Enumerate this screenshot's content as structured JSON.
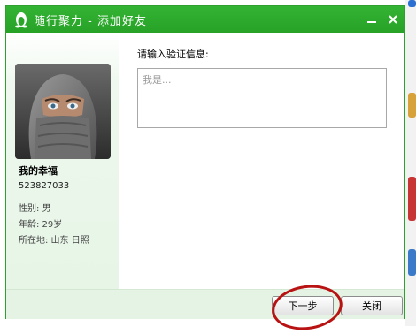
{
  "window": {
    "title": "随行聚力 - 添加好友"
  },
  "contact": {
    "nickname": "我的幸福",
    "qq_number": "523827033",
    "gender": "性别: 男",
    "age": "年龄: 29岁",
    "location": "所在地: 山东 日照"
  },
  "verification": {
    "prompt": "请输入验证信息:",
    "placeholder": "我是..."
  },
  "buttons": {
    "next": "下一步",
    "close": "关闭"
  },
  "colors": {
    "titlebar": "#2aa52a",
    "footer": "#e4f3e4",
    "annotation_circle": "#b81212"
  },
  "icons": {
    "title_logo": "penguin-icon",
    "minimize": "minimize-icon",
    "close": "close-icon"
  }
}
